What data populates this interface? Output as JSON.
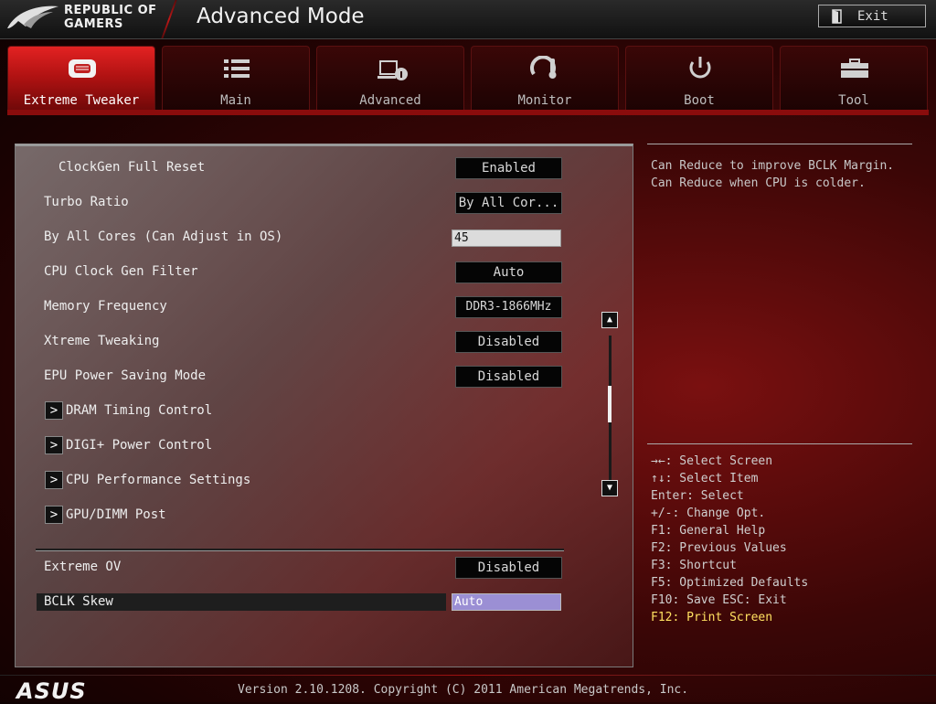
{
  "header": {
    "brand_line1": "REPUBLIC OF",
    "brand_line2": "GAMERS",
    "mode_title": "Advanced Mode",
    "exit_label": "Exit"
  },
  "tabs": [
    {
      "label": "Extreme Tweaker",
      "icon": "tweaker-icon",
      "active": true
    },
    {
      "label": "Main",
      "icon": "list-icon",
      "active": false
    },
    {
      "label": "Advanced",
      "icon": "advanced-settings-icon",
      "active": false
    },
    {
      "label": "Monitor",
      "icon": "thermometer-gauge-icon",
      "active": false
    },
    {
      "label": "Boot",
      "icon": "power-icon",
      "active": false
    },
    {
      "label": "Tool",
      "icon": "toolbox-icon",
      "active": false
    }
  ],
  "settings": {
    "clockgen_reset": {
      "label": "ClockGen Full Reset",
      "value": "Enabled"
    },
    "turbo_ratio": {
      "label": "Turbo Ratio",
      "value": "By All Cor..."
    },
    "by_all_cores": {
      "label": "By All Cores (Can Adjust in OS)",
      "value": "45"
    },
    "cpu_clock_filter": {
      "label": "CPU Clock Gen Filter",
      "value": "Auto"
    },
    "memory_frequency": {
      "label": "Memory Frequency",
      "value": "DDR3-1866MHz"
    },
    "xtreme_tweaking": {
      "label": "Xtreme Tweaking",
      "value": "Disabled"
    },
    "epu_power": {
      "label": "EPU Power Saving Mode",
      "value": "Disabled"
    },
    "submenus": [
      "DRAM Timing Control",
      "DIGI+ Power Control",
      "CPU Performance Settings",
      "GPU/DIMM Post"
    ],
    "submenu_arrow": ">",
    "extreme_ov": {
      "label": "Extreme OV",
      "value": "Disabled"
    },
    "bclk_skew": {
      "label": "BCLK Skew",
      "value": "Auto"
    }
  },
  "scroll": {
    "up_glyph": "▲",
    "down_glyph": "▼",
    "position": 0.4
  },
  "help": {
    "line1": "Can Reduce to improve BCLK Margin.",
    "line2": "Can Reduce when CPU is colder."
  },
  "keys": {
    "select_screen": "→←: Select Screen",
    "select_item": "↑↓: Select Item",
    "enter": "Enter: Select",
    "change": "+/-: Change Opt.",
    "f1": "F1: General Help",
    "f2": "F2: Previous Values",
    "f3": "F3: Shortcut",
    "f5": "F5: Optimized Defaults",
    "f10": "F10: Save  ESC: Exit",
    "f12": "F12: Print Screen"
  },
  "footer": {
    "asus_logo": "ASUS",
    "version": "Version 2.10.1208. Copyright (C) 2011 American Megatrends, Inc."
  },
  "colors": {
    "accent_red": "#c01818",
    "selected_value": "#9b8fd4",
    "highlight_key": "#ffe060"
  }
}
